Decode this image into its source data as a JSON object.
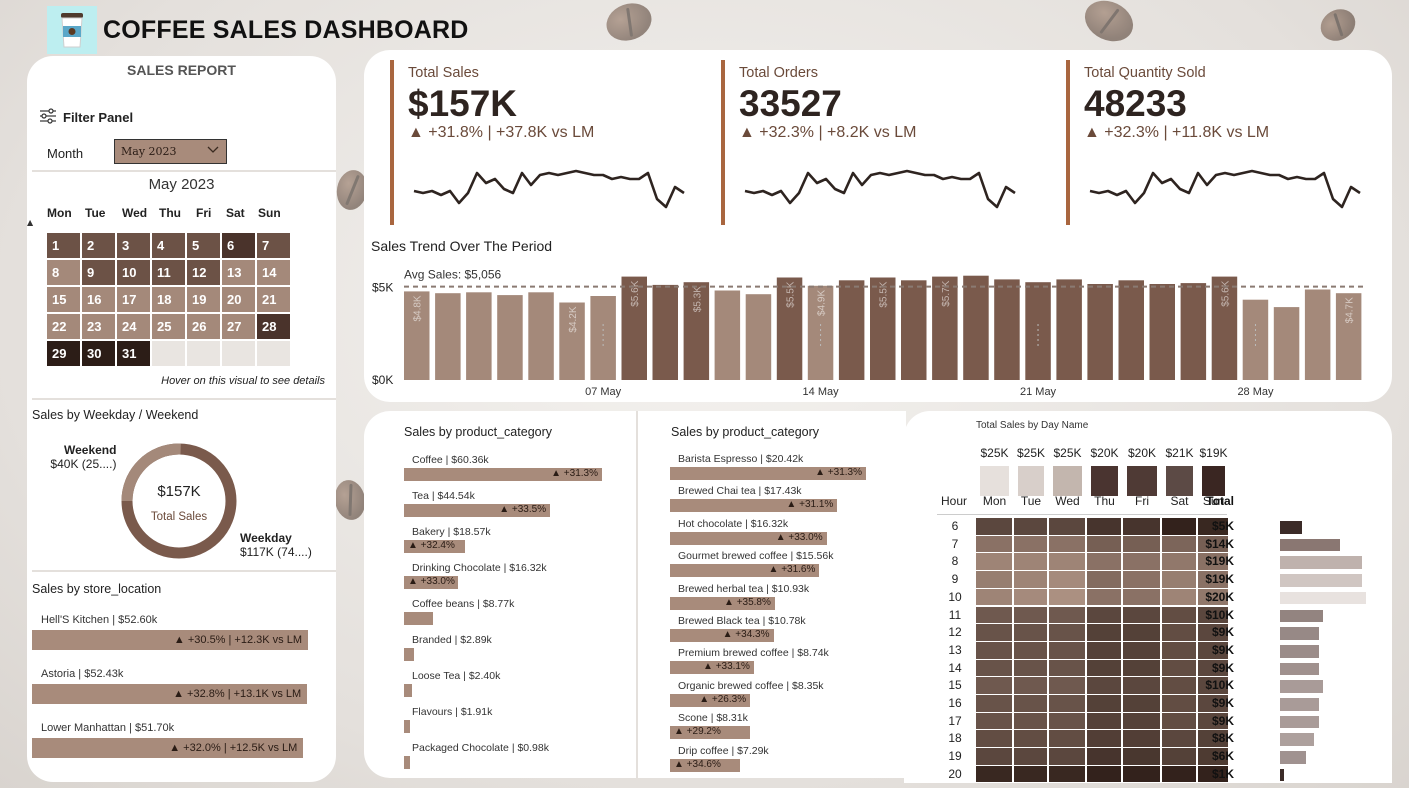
{
  "header": {
    "title": "COFFEE SALES DASHBOARD",
    "logo_icon": "coffee-cup-icon"
  },
  "sidebar": {
    "title": "SALES REPORT",
    "filter_label": "Filter Panel",
    "month_label": "Month",
    "month_value": "May 2023",
    "calendar": {
      "title": "May 2023",
      "weekdays": [
        "Mon",
        "Tue",
        "Wed",
        "Thu",
        "Fri",
        "Sat",
        "Sun"
      ],
      "days": [
        {
          "d": "1",
          "c": "#6c5246"
        },
        {
          "d": "2",
          "c": "#6c5246"
        },
        {
          "d": "3",
          "c": "#6c5246"
        },
        {
          "d": "4",
          "c": "#6c5246"
        },
        {
          "d": "5",
          "c": "#6c5246"
        },
        {
          "d": "6",
          "c": "#4a332b"
        },
        {
          "d": "7",
          "c": "#6c5246"
        },
        {
          "d": "8",
          "c": "#a4897a"
        },
        {
          "d": "9",
          "c": "#6c5246"
        },
        {
          "d": "10",
          "c": "#6c5246"
        },
        {
          "d": "11",
          "c": "#6c5246"
        },
        {
          "d": "12",
          "c": "#6c5246"
        },
        {
          "d": "13",
          "c": "#a4897a"
        },
        {
          "d": "14",
          "c": "#a4897a"
        },
        {
          "d": "15",
          "c": "#a4897a"
        },
        {
          "d": "16",
          "c": "#a4897a"
        },
        {
          "d": "17",
          "c": "#a4897a"
        },
        {
          "d": "18",
          "c": "#a4897a"
        },
        {
          "d": "19",
          "c": "#a4897a"
        },
        {
          "d": "20",
          "c": "#a4897a"
        },
        {
          "d": "21",
          "c": "#a4897a"
        },
        {
          "d": "22",
          "c": "#a4897a"
        },
        {
          "d": "23",
          "c": "#a4897a"
        },
        {
          "d": "24",
          "c": "#a4897a"
        },
        {
          "d": "25",
          "c": "#a4897a"
        },
        {
          "d": "26",
          "c": "#a4897a"
        },
        {
          "d": "27",
          "c": "#a4897a"
        },
        {
          "d": "28",
          "c": "#4a332b"
        },
        {
          "d": "29",
          "c": "#2c1d17"
        },
        {
          "d": "30",
          "c": "#2c1d17"
        },
        {
          "d": "31",
          "c": "#2c1d17"
        },
        {
          "d": "",
          "c": "#e9e5e1"
        },
        {
          "d": "",
          "c": "#e9e5e1"
        },
        {
          "d": "",
          "c": "#e9e5e1"
        },
        {
          "d": "",
          "c": "#e9e5e1"
        }
      ],
      "hover_note": "Hover on this visual to see details"
    },
    "weekday_weekend": {
      "title": "Sales by Weekday / Weekend",
      "center_value": "$157K",
      "center_label": "Total Sales",
      "weekend_label": "Weekend",
      "weekend_value": "$40K (25....)",
      "weekday_label": "Weekday",
      "weekday_value": "$117K (74....)",
      "weekend_share": 0.255
    },
    "store_location": {
      "title": "Sales by store_location",
      "items": [
        {
          "name": "Hell'S Kitchen | $52.60k",
          "delta": "▲ +30.5% | +12.3K vs LM",
          "share": 1.0
        },
        {
          "name": "Astoria | $52.43k",
          "delta": "▲ +32.8% | +13.1K vs LM",
          "share": 0.997
        },
        {
          "name": "Lower Manhattan | $51.70k",
          "delta": "▲ +32.0% | +12.5K vs LM",
          "share": 0.983
        }
      ]
    }
  },
  "kpis": [
    {
      "label": "Total Sales",
      "value": "$157K",
      "delta": "▲ +31.8% | +37.8K vs LM"
    },
    {
      "label": "Total Orders",
      "value": "33527",
      "delta": "▲ +32.3% | +8.2K vs LM"
    },
    {
      "label": "Total Quantity Sold",
      "value": "48233",
      "delta": "▲ +32.3% | +11.8K vs LM"
    }
  ],
  "chart_data": [
    {
      "type": "line",
      "title": "Total Sales sparkline",
      "values": [
        4.7,
        4.6,
        4.7,
        4.5,
        4.7,
        4.1,
        4.6,
        5.6,
        5.1,
        5.3,
        4.8,
        4.6,
        5.6,
        5.0,
        5.5,
        5.6,
        5.5,
        5.6,
        5.7,
        5.6,
        5.5,
        5.5,
        5.3,
        5.4,
        5.3,
        5.3,
        5.6,
        4.3,
        3.9,
        4.9,
        4.6
      ]
    },
    {
      "type": "line",
      "title": "Total Orders sparkline",
      "values": [
        4.7,
        4.6,
        4.7,
        4.5,
        4.7,
        4.1,
        4.6,
        5.6,
        5.1,
        5.3,
        4.8,
        4.6,
        5.6,
        5.0,
        5.5,
        5.6,
        5.5,
        5.6,
        5.7,
        5.6,
        5.5,
        5.5,
        5.3,
        5.4,
        5.3,
        5.3,
        5.6,
        4.3,
        3.9,
        4.9,
        4.6
      ]
    },
    {
      "type": "line",
      "title": "Total Quantity sparkline",
      "values": [
        4.7,
        4.6,
        4.7,
        4.5,
        4.7,
        4.1,
        4.6,
        5.6,
        5.1,
        5.3,
        4.8,
        4.6,
        5.6,
        5.0,
        5.5,
        5.6,
        5.5,
        5.6,
        5.7,
        5.6,
        5.5,
        5.5,
        5.3,
        5.4,
        5.3,
        5.3,
        5.6,
        4.3,
        3.9,
        4.9,
        4.6
      ]
    },
    {
      "type": "bar",
      "title": "Sales Trend Over The Period",
      "avg_label": "Avg Sales: $5,056",
      "avg": 5056,
      "ylim": [
        0,
        6500
      ],
      "yticks": [
        {
          "v": 0,
          "t": "$0K"
        },
        {
          "v": 5000,
          "t": "$5K"
        }
      ],
      "xticks": [
        {
          "i": 6,
          "t": "07 May"
        },
        {
          "i": 13,
          "t": "14 May"
        },
        {
          "i": 20,
          "t": "21 May"
        },
        {
          "i": 27,
          "t": "28 May"
        }
      ],
      "values": [
        4800,
        4700,
        4750,
        4600,
        4750,
        4200,
        4550,
        5600,
        5150,
        5300,
        4850,
        4650,
        5550,
        5100,
        5400,
        5550,
        5400,
        5600,
        5650,
        5450,
        5300,
        5450,
        5200,
        5400,
        5200,
        5250,
        5600,
        4350,
        3950,
        4900,
        4700
      ],
      "colors": [
        "#a4897a",
        "#a4897a",
        "#a4897a",
        "#a4897a",
        "#a4897a",
        "#a4897a",
        "#a4897a",
        "#7a5a4c",
        "#7a5a4c",
        "#7a5a4c",
        "#a4897a",
        "#a4897a",
        "#7a5a4c",
        "#a4897a",
        "#7a5a4c",
        "#7a5a4c",
        "#7a5a4c",
        "#7a5a4c",
        "#7a5a4c",
        "#7a5a4c",
        "#7a5a4c",
        "#7a5a4c",
        "#7a5a4c",
        "#7a5a4c",
        "#7a5a4c",
        "#7a5a4c",
        "#7a5a4c",
        "#a4897a",
        "#a4897a",
        "#a4897a",
        "#a4897a"
      ],
      "data_labels": [
        "$4.8K",
        "",
        "",
        "",
        "",
        "$4.2K",
        "",
        "$5.6K",
        "",
        "$5.3K",
        "",
        "",
        "$5.5K",
        "$4.9K",
        "",
        "$5.5K",
        "",
        "$5.7K",
        "",
        "",
        "",
        "",
        "",
        "",
        "",
        "",
        "$5.6K",
        "",
        "",
        "",
        "$4.7K"
      ]
    },
    {
      "type": "bar",
      "title": "Sales by product_category",
      "items": [
        {
          "name": "Coffee | $60.36k",
          "value": 60.36,
          "delta": "▲ +31.3%"
        },
        {
          "name": "Tea | $44.54k",
          "value": 44.54,
          "delta": "▲ +33.5%"
        },
        {
          "name": "Bakery | $18.57k",
          "value": 18.57,
          "delta": "▲ +32.4%"
        },
        {
          "name": "Drinking Chocolate | $16.32k",
          "value": 16.32,
          "delta": "▲ +33.0%"
        },
        {
          "name": "Coffee beans | $8.77k",
          "value": 8.77,
          "delta": ""
        },
        {
          "name": "Branded | $2.89k",
          "value": 2.89,
          "delta": ""
        },
        {
          "name": "Loose Tea | $2.40k",
          "value": 2.4,
          "delta": ""
        },
        {
          "name": "Flavours | $1.91k",
          "value": 1.91,
          "delta": ""
        },
        {
          "name": "Packaged Chocolate | $0.98k",
          "value": 0.98,
          "delta": ""
        }
      ]
    },
    {
      "type": "bar",
      "title": "Sales by product_category",
      "items": [
        {
          "name": "Barista Espresso | $20.42k",
          "value": 20.42,
          "delta": "▲ +31.3%"
        },
        {
          "name": "Brewed Chai tea | $17.43k",
          "value": 17.43,
          "delta": "▲ +31.1%"
        },
        {
          "name": "Hot chocolate | $16.32k",
          "value": 16.32,
          "delta": "▲ +33.0%"
        },
        {
          "name": "Gourmet brewed coffee | $15.56k",
          "value": 15.56,
          "delta": "▲ +31.6%"
        },
        {
          "name": "Brewed herbal tea | $10.93k",
          "value": 10.93,
          "delta": "▲ +35.8%"
        },
        {
          "name": "Brewed Black tea | $10.78k",
          "value": 10.78,
          "delta": "▲ +34.3%"
        },
        {
          "name": "Premium brewed coffee | $8.74k",
          "value": 8.74,
          "delta": "▲ +33.1%"
        },
        {
          "name": "Organic brewed coffee | $8.35k",
          "value": 8.35,
          "delta": "▲ +26.3%"
        },
        {
          "name": "Scone | $8.31k",
          "value": 8.31,
          "delta": "▲ +29.2%"
        },
        {
          "name": "Drip coffee | $7.29k",
          "value": 7.29,
          "delta": "▲ +34.6%"
        }
      ]
    },
    {
      "type": "heatmap",
      "title": "Total Sales by Day Name",
      "hour_label": "Hour",
      "total_label": "Total",
      "days": [
        "Mon",
        "Tue",
        "Wed",
        "Thu",
        "Fri",
        "Sat",
        "Sun"
      ],
      "day_totals": [
        "$25K",
        "$25K",
        "$25K",
        "$20K",
        "$20K",
        "$21K",
        "$19K"
      ],
      "day_colors": [
        "#e6e0dc",
        "#d8cfca",
        "#c3b6ae",
        "#4a3430",
        "#4f3a35",
        "#5c4a45",
        "#3a2622"
      ],
      "hours": [
        "6",
        "7",
        "8",
        "9",
        "10",
        "11",
        "12",
        "13",
        "14",
        "15",
        "16",
        "17",
        "18",
        "19",
        "20"
      ],
      "hour_totals": [
        "$5K",
        "$14K",
        "$19K",
        "$19K",
        "$20K",
        "$10K",
        "$9K",
        "$9K",
        "$9K",
        "$10K",
        "$9K",
        "$9K",
        "$8K",
        "$6K",
        "$1K"
      ],
      "hour_values": [
        5,
        14,
        19,
        19,
        20,
        10,
        9,
        9,
        9,
        10,
        9,
        9,
        8,
        6,
        1
      ],
      "hour_bar_colors": [
        "#3b2b28",
        "#8a7772",
        "#bfb2ad",
        "#d0c6c2",
        "#e8e2df",
        "#938480",
        "#978986",
        "#9b8c89",
        "#a0918e",
        "#a99b98",
        "#a99b98",
        "#a99b98",
        "#ada09d",
        "#a09290",
        "#3b2b28"
      ],
      "grid": [
        [
          0.35,
          0.35,
          0.35,
          0.2,
          0.2,
          0.05,
          0.1
        ],
        [
          0.7,
          0.7,
          0.7,
          0.55,
          0.55,
          0.6,
          0.55
        ],
        [
          0.85,
          0.85,
          0.85,
          0.7,
          0.7,
          0.75,
          0.7
        ],
        [
          0.8,
          0.85,
          0.9,
          0.65,
          0.7,
          0.8,
          0.7
        ],
        [
          0.85,
          0.9,
          0.95,
          0.7,
          0.7,
          0.85,
          0.75
        ],
        [
          0.5,
          0.5,
          0.5,
          0.35,
          0.35,
          0.4,
          0.35
        ],
        [
          0.45,
          0.45,
          0.45,
          0.3,
          0.3,
          0.4,
          0.35
        ],
        [
          0.45,
          0.45,
          0.45,
          0.3,
          0.3,
          0.4,
          0.35
        ],
        [
          0.45,
          0.45,
          0.45,
          0.3,
          0.3,
          0.4,
          0.35
        ],
        [
          0.5,
          0.5,
          0.5,
          0.35,
          0.35,
          0.4,
          0.35
        ],
        [
          0.45,
          0.45,
          0.45,
          0.3,
          0.3,
          0.4,
          0.35
        ],
        [
          0.45,
          0.45,
          0.45,
          0.3,
          0.3,
          0.4,
          0.35
        ],
        [
          0.4,
          0.4,
          0.4,
          0.28,
          0.28,
          0.35,
          0.3
        ],
        [
          0.35,
          0.35,
          0.35,
          0.2,
          0.22,
          0.3,
          0.25
        ],
        [
          0.1,
          0.1,
          0.1,
          0.05,
          0.05,
          0.05,
          0.05
        ]
      ]
    }
  ]
}
